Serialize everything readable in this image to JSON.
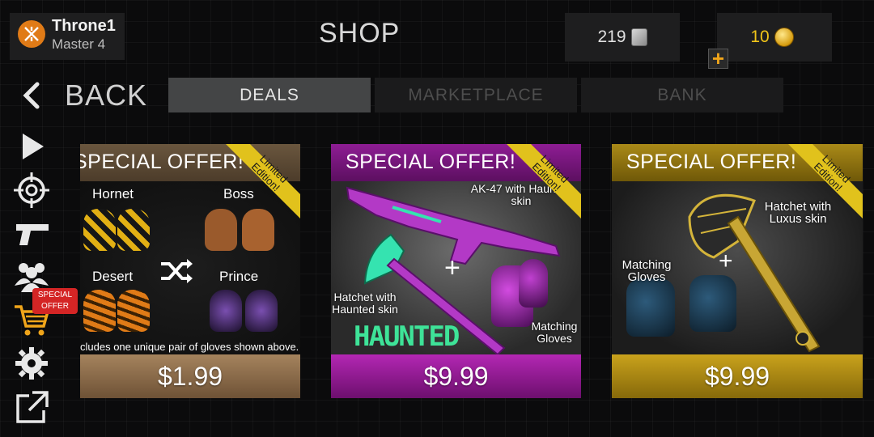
{
  "player": {
    "name": "Throne1",
    "rank": "Master 4"
  },
  "page": {
    "title": "SHOP"
  },
  "currency": {
    "silver": "219",
    "gold": "10",
    "add_label": "+"
  },
  "nav": {
    "back_label": "BACK"
  },
  "tabs": [
    {
      "label": "DEALS",
      "active": true
    },
    {
      "label": "MARKETPLACE",
      "active": false
    },
    {
      "label": "BANK",
      "active": false
    }
  ],
  "sidebar": {
    "special_badge": "SPECIAL OFFER",
    "icons": [
      "play-icon",
      "crosshair-icon",
      "pistol-icon",
      "friends-icon",
      "shop-cart-icon",
      "settings-icon",
      "external-link-icon"
    ]
  },
  "cards": [
    {
      "title": "SPECIAL OFFER!",
      "ribbon": "Limited Edition!",
      "items": [
        "Hornet",
        "Boss",
        "Desert",
        "Prince"
      ],
      "footnote": "cludes one unique pair of gloves shown above.",
      "price": "$1.99",
      "color": "#8a6a4a"
    },
    {
      "title": "SPECIAL OFFER!",
      "ribbon": "Limited Edition!",
      "items": [
        "AK-47 with Haunted skin",
        "Hatchet with Haunted skin",
        "Matching Gloves"
      ],
      "plus": "+",
      "logo_text": "HAUNTED",
      "price": "$9.99",
      "color": "#9c1c9a"
    },
    {
      "title": "SPECIAL OFFER!",
      "ribbon": "Limited Edition!",
      "items": [
        "Hatchet with Luxus skin",
        "Matching Gloves"
      ],
      "plus": "+",
      "price": "$9.99",
      "color": "#b28f14"
    }
  ]
}
